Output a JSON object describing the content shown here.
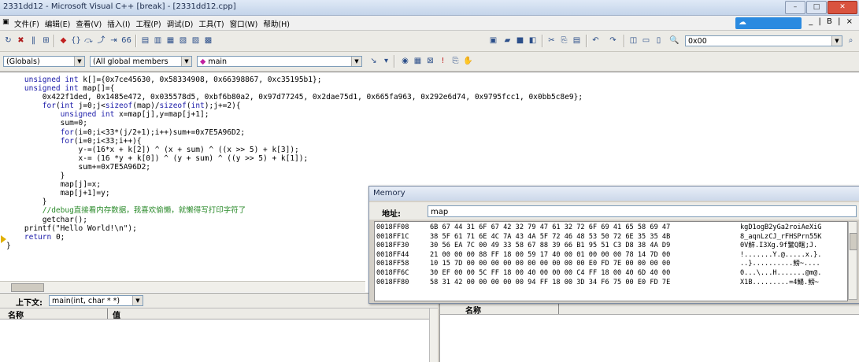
{
  "window": {
    "title": "2331dd12 - Microsoft Visual C++ [break] - [2331dd12.cpp]"
  },
  "menu": {
    "items": [
      "文件(F)",
      "编辑(E)",
      "查看(V)",
      "插入(I)",
      "工程(P)",
      "调试(D)",
      "工具(T)",
      "窗口(W)",
      "帮助(H)"
    ],
    "mdi_buttons": "_ | B | ×"
  },
  "toolbar": {
    "find_combo_value": "0x00",
    "globals_combo": "(Globals)",
    "members_combo": "(All global members",
    "function_combo": "main"
  },
  "code_lines": [
    "    unsigned int k[]={0x7ce45630, 0x58334908, 0x66398867, 0xc35195b1};",
    "    unsigned int map[]={",
    "        0x422f1ded, 0x1485e472, 0x035578d5, 0xbf6b80a2, 0x97d77245, 0x2dae75d1, 0x665fa963, 0x292e6d74, 0x9795fcc1, 0x0bb5c8e9};",
    "        for(int j=0;j<sizeof(map)/sizeof(int);j+=2){",
    "            unsigned int x=map[j],y=map[j+1];",
    "            sum=0;",
    "            for(i=0;i<33*(j/2+1);i++)sum+=0x7E5A96D2;",
    "            for(i=0;i<33;i++){",
    "                y-=(16*x + k[2]) ^ (x + sum) ^ ((x >> 5) + k[3]);",
    "                x-= (16 *y + k[0]) ^ (y + sum) ^ ((y >> 5) + k[1]);",
    "                sum+=0x7E5A96D2;",
    "            }",
    "            map[j]=x;",
    "            map[j+1]=y;",
    "        }",
    "        //debug直接看内存数据，我喜欢偷懒，就懒得写打印字符了",
    "        getchar();",
    "    printf(\"Hello World!\\n\");",
    "    return 0;",
    "}"
  ],
  "context": {
    "label": "上下文:",
    "value": "main(int, char * *)"
  },
  "variables": {
    "col_name": "名称",
    "col_value": "值"
  },
  "watch": {
    "col_name": "名称"
  },
  "memory": {
    "title": "Memory",
    "address_label": "地址:",
    "address_value": "map",
    "rows": [
      {
        "addr": "0018FF08",
        "hex": "6B 67 44 31 6F 67 42 32 79 47 61 32 72 6F 69 41 65 58 69 47",
        "ascii": "kgD1ogB2yGa2roiAeXiG"
      },
      {
        "addr": "0018FF1C",
        "hex": "38 5F 61 71 6E 4C 7A 43 4A 5F 72 46 48 53 50 72 6E 35 35 4B",
        "ascii": "8_aqnLzCJ_rFHSPrn55K"
      },
      {
        "addr": "0018FF30",
        "hex": "30 56 EA 7C 00 49 33 58 67 88 39 66 B1 95 51 C3 D8 38 4A D9",
        "ascii": "0V觧.I3Xg.9f鼜Q瞎;J."
      },
      {
        "addr": "0018FF44",
        "hex": "21 00 00 00 88 FF 18 00 59 17 40 00 01 00 00 00 78 14 7D 00",
        "ascii": "!.......Y.@.....x.}."
      },
      {
        "addr": "0018FF58",
        "hex": "10 15 7D 00 00 00 00 00 00 00 00 00 00 E0 FD 7E 00 00 00 00",
        "ascii": "..}..........鳑~...."
      },
      {
        "addr": "0018FF6C",
        "hex": "30 EF 00 00 5C FF 18 00 40 00 00 00 C4 FF 18 00 40 6D 40 00",
        "ascii": "0...\\...H.......@m@."
      },
      {
        "addr": "0018FF80",
        "hex": "58 31 42 00 00 00 00 00 94 FF 18 00 3D 34 F6 75 00 E0 FD 7E",
        "ascii": "X1B.........=4鰑.鳑~"
      }
    ]
  }
}
